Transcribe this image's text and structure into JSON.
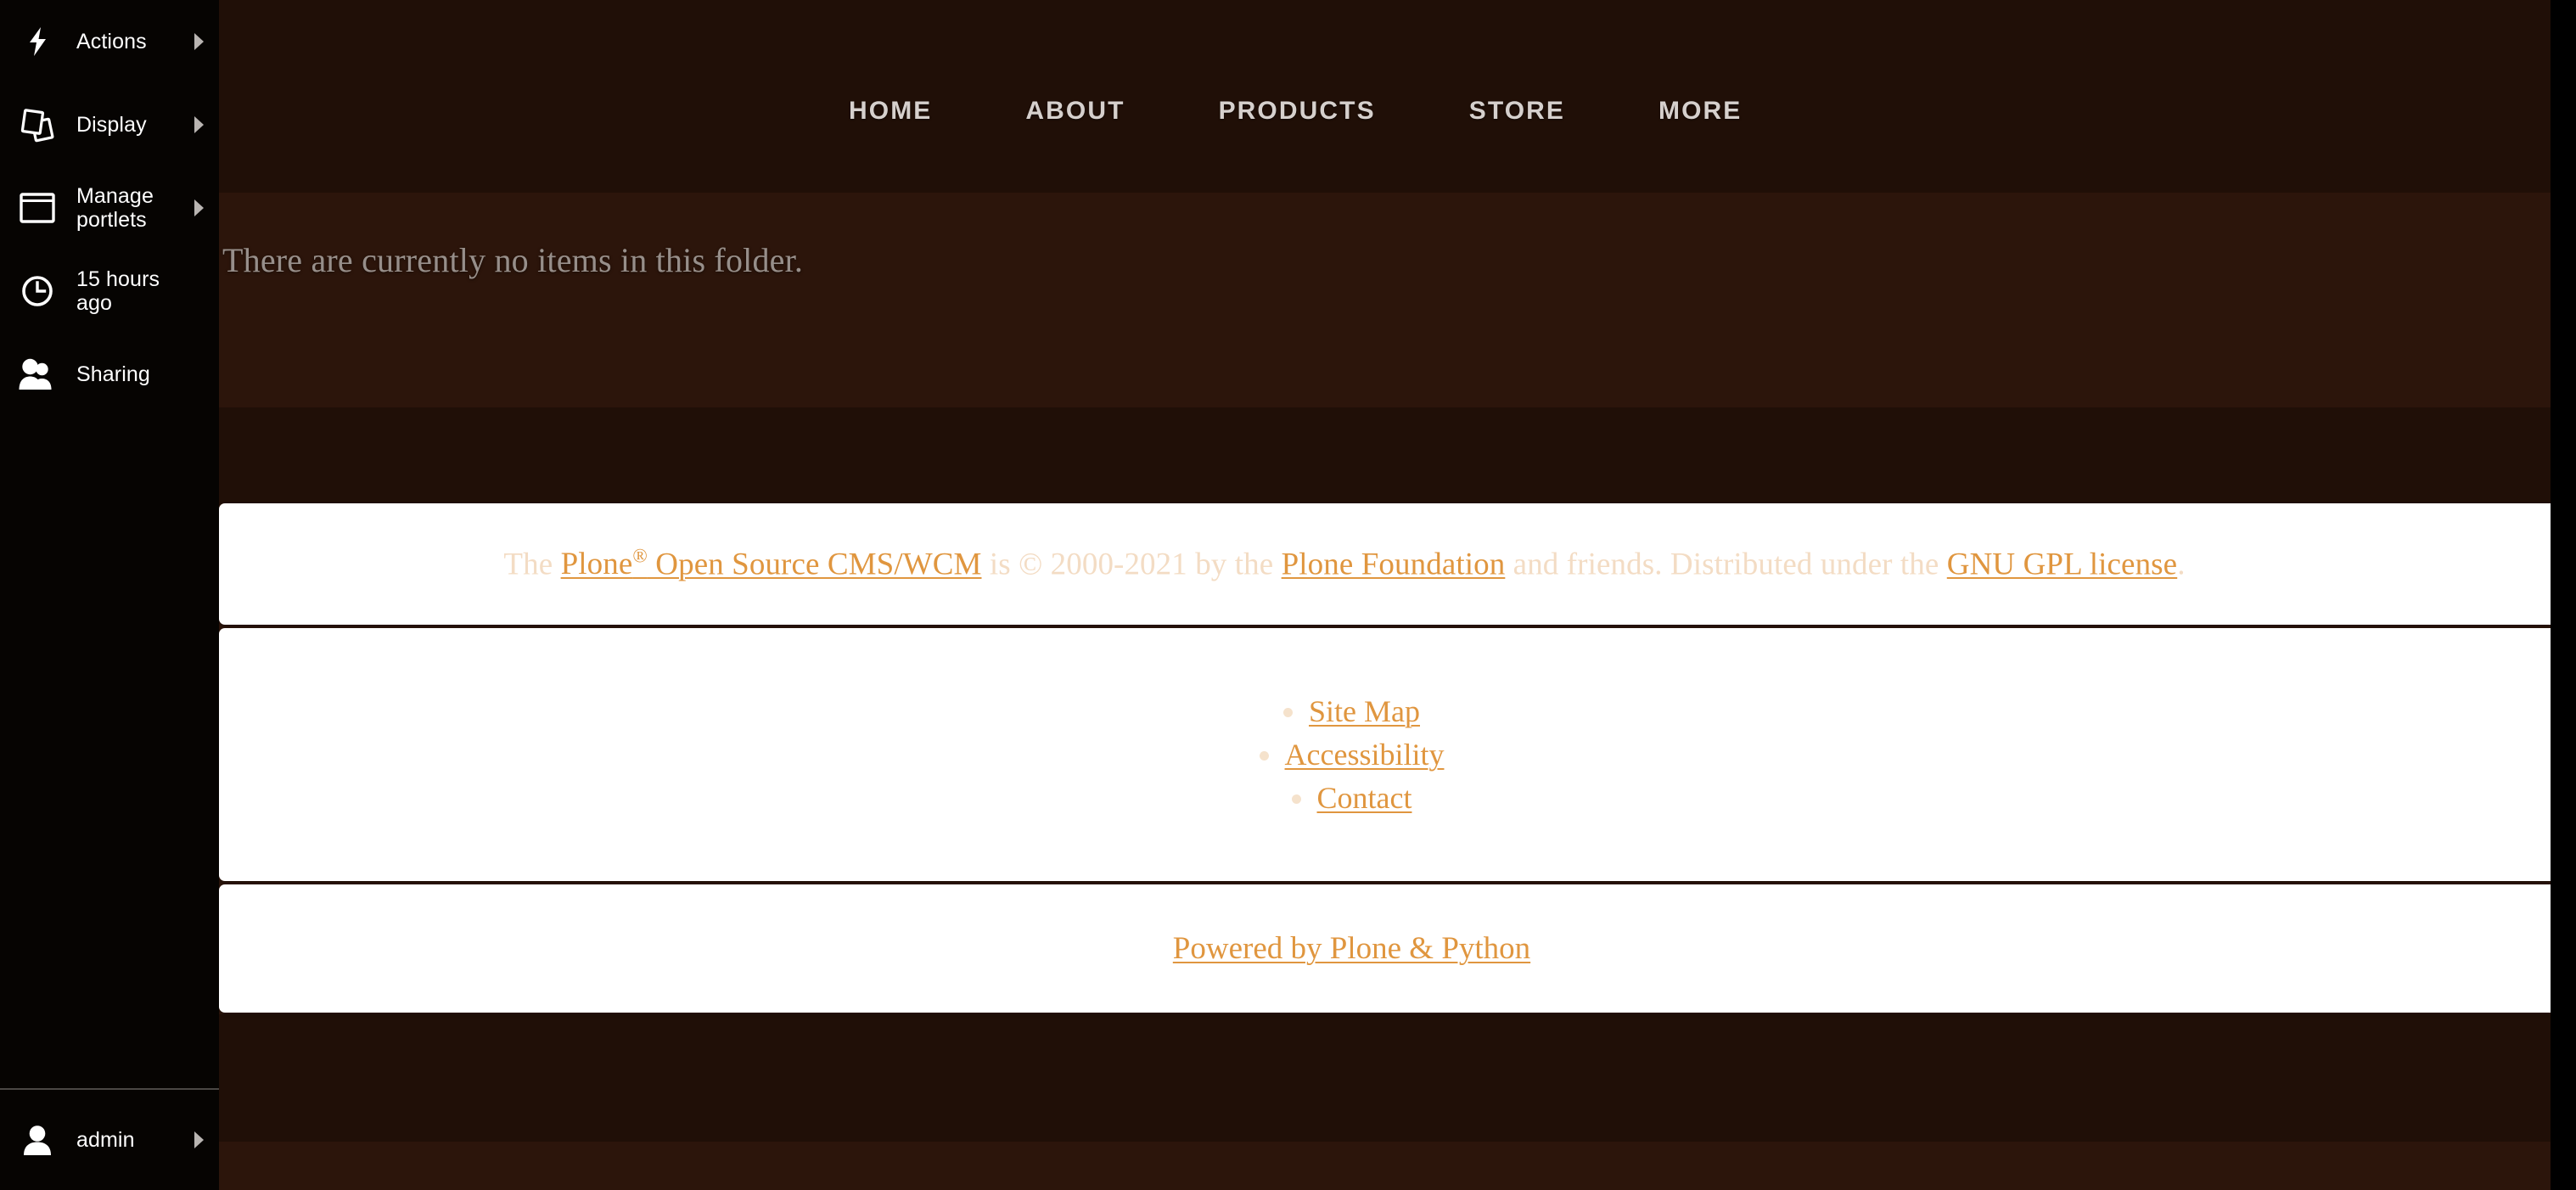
{
  "sidebar": {
    "items": [
      {
        "label": "Actions",
        "icon": "lightning-bolt-icon",
        "has_submenu": true
      },
      {
        "label": "Display",
        "icon": "stacked-pages-icon",
        "has_submenu": true
      },
      {
        "label": "Manage portlets",
        "icon": "window-frame-icon",
        "has_submenu": true
      },
      {
        "label": "15 hours ago",
        "icon": "clock-icon",
        "has_submenu": false
      },
      {
        "label": "Sharing",
        "icon": "two-users-icon",
        "has_submenu": false
      }
    ],
    "user": {
      "label": "admin",
      "icon": "person-icon",
      "has_submenu": true
    }
  },
  "nav": {
    "items": [
      {
        "label": "HOME"
      },
      {
        "label": "ABOUT"
      },
      {
        "label": "PRODUCTS"
      },
      {
        "label": "STORE"
      },
      {
        "label": "MORE"
      }
    ]
  },
  "content": {
    "empty_message": "There are currently no items in this folder."
  },
  "footer": {
    "copyright": {
      "lead": "The ",
      "link_plone": "Plone",
      "registered_mark": "®",
      "link_cms": " Open Source CMS/WCM",
      "mid": " is © 2000-2021 by the ",
      "link_foundation": "Plone Foundation",
      "tail": " and friends. Distributed under the ",
      "link_license": "GNU GPL license",
      "period": "."
    },
    "site_actions": [
      {
        "label": "Site Map"
      },
      {
        "label": "Accessibility"
      },
      {
        "label": "Contact"
      }
    ],
    "powered_by": "Powered by Plone & Python"
  },
  "colors": {
    "link": "#e0963f",
    "footer_text": "#f3dcc4",
    "sidebar_bg": "#060402",
    "panel_bg": "#ffffff",
    "nav_text": "#d6d0cd",
    "page_bg": "#3a1d10"
  }
}
